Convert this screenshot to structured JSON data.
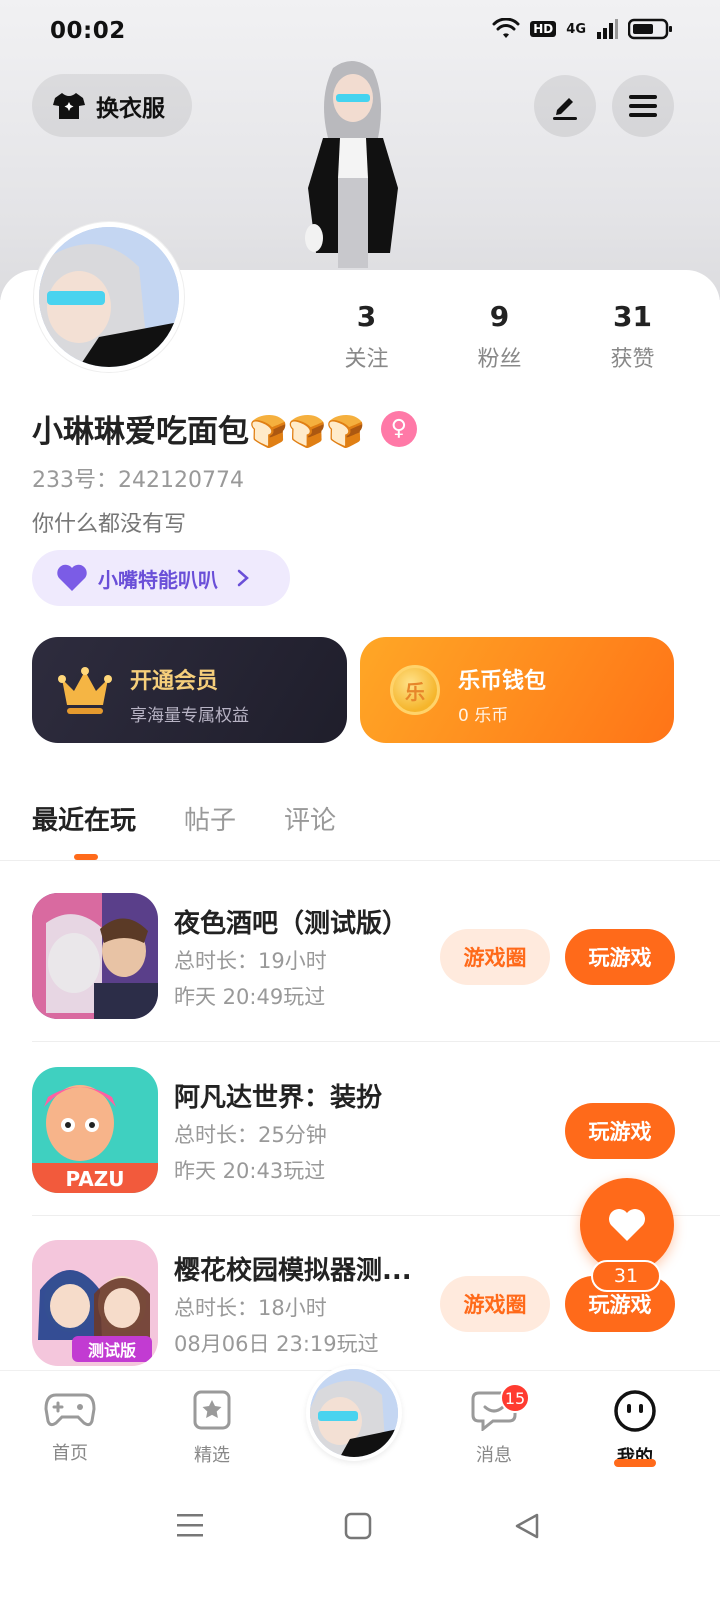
{
  "status_bar": {
    "time": "00:02",
    "hd": "HD",
    "network": "4G"
  },
  "header": {
    "outfit_label": "换衣服"
  },
  "profile": {
    "name": "小琳琳爱吃面包🍞🍞🍞",
    "gender_symbol": "♀",
    "uid": "233号：242120774",
    "bio": "你什么都没有写",
    "tag": "小嘴特能叭叭",
    "stats": [
      {
        "value": "3",
        "label": "关注"
      },
      {
        "value": "9",
        "label": "粉丝"
      },
      {
        "value": "31",
        "label": "获赞"
      }
    ]
  },
  "cards": {
    "vip": {
      "title": "开通会员",
      "subtitle": "享海量专属权益"
    },
    "wallet": {
      "title": "乐币钱包",
      "subtitle": "0 乐币",
      "coin_char": "乐"
    }
  },
  "tabs": [
    {
      "label": "最近在玩",
      "active": true
    },
    {
      "label": "帖子",
      "active": false
    },
    {
      "label": "评论",
      "active": false
    }
  ],
  "games": [
    {
      "title": "夜色酒吧（测试版）",
      "duration": "总时长：19小时",
      "last_played": "昨天 20:49玩过",
      "circle_label": "游戏圈",
      "play_label": "玩游戏"
    },
    {
      "title": "阿凡达世界：装扮",
      "duration": "总时长：25分钟",
      "last_played": "昨天 20:43玩过",
      "play_label": "玩游戏",
      "icon_text": "PAZU"
    },
    {
      "title": "樱花校园模拟器测...",
      "duration": "总时长：18小时",
      "last_played": "08月06日 23:19玩过",
      "circle_label": "游戏圈",
      "play_label": "玩游戏",
      "icon_text": "测试版"
    }
  ],
  "like_fab": {
    "count": "31"
  },
  "bottom_nav": {
    "items": [
      {
        "label": "首页",
        "icon": "gamepad-icon"
      },
      {
        "label": "精选",
        "icon": "star-icon"
      },
      {
        "label": "消息",
        "icon": "chat-icon",
        "badge": "15"
      },
      {
        "label": "我的",
        "icon": "face-icon",
        "active": true
      }
    ]
  },
  "colors": {
    "accent": "#ff6a1a",
    "vip_gold": "#f6cf7b",
    "tag_purple": "#6a4fd8"
  }
}
